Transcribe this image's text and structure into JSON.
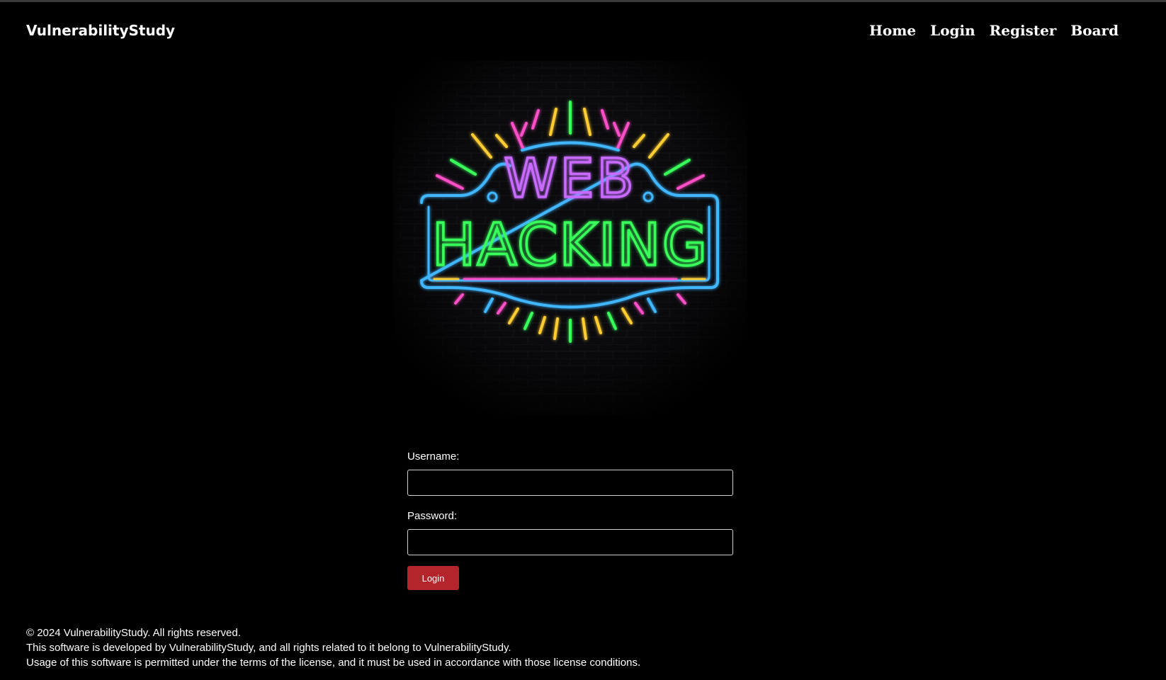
{
  "header": {
    "brand": "VulnerabilityStudy",
    "nav": [
      "Home",
      "Login",
      "Register",
      "Board"
    ]
  },
  "hero": {
    "line1": "WEB",
    "line2": "HACKING",
    "colors": {
      "blue": "#3fb6ff",
      "pink": "#ff4fc8",
      "green": "#39ff5a",
      "yellow": "#ffcc33",
      "purple": "#c86bff"
    }
  },
  "form": {
    "username_label": "Username:",
    "username_value": "",
    "password_label": "Password:",
    "password_value": "",
    "submit_label": "Login",
    "submit_color": "#b3252a"
  },
  "footer": {
    "lines": [
      "© 2024 VulnerabilityStudy. All rights reserved.",
      "This software is developed by VulnerabilityStudy, and all rights related to it belong to VulnerabilityStudy.",
      "Usage of this software is permitted under the terms of the license, and it must be used in accordance with those license conditions."
    ]
  }
}
